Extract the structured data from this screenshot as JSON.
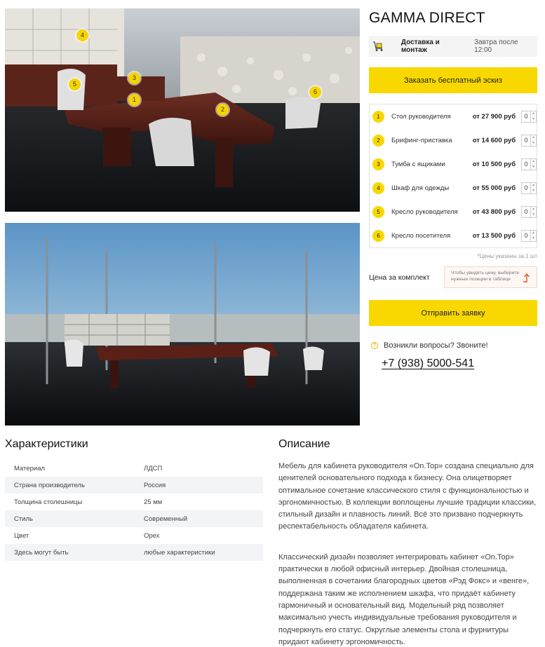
{
  "product": {
    "title": "GAMMA DIRECT"
  },
  "delivery": {
    "label": "Доставка и монтаж",
    "when": "Завтра после 12:00",
    "icon": "truck-icon"
  },
  "buttons": {
    "sketch": "Заказать бесплатный эскиз",
    "send": "Отправить заявку"
  },
  "photo_markers": [
    "1",
    "2",
    "3",
    "4",
    "5",
    "6"
  ],
  "items": [
    {
      "num": "1",
      "name": "Стол руководителя",
      "price": "от 27 900 руб",
      "qty": "0"
    },
    {
      "num": "2",
      "name": "Брифинг-приставка",
      "price": "от 14 600 руб",
      "qty": "0"
    },
    {
      "num": "3",
      "name": "Тумба с ящиками",
      "price": "от 10 500 руб",
      "qty": "0"
    },
    {
      "num": "4",
      "name": "Шкаф для одежды",
      "price": "от 55 000 руб",
      "qty": "0"
    },
    {
      "num": "5",
      "name": "Кресло руководителя",
      "price": "от 43 800 руб",
      "qty": "0"
    },
    {
      "num": "6",
      "name": "Кресло посетителя",
      "price": "от 13 500 руб",
      "qty": "0"
    }
  ],
  "price_note": "*Цены указаны за 1 шт",
  "kit": {
    "label": "Цена за комплект",
    "hint": "Чтобы увидеть цену, выберите нужные позиции в таблице"
  },
  "contact": {
    "question": "Возникли вопросы? Звоните!",
    "phone": "+7 (938) 5000-541"
  },
  "characteristics": {
    "title": "Характеристики",
    "rows": [
      {
        "key": "Материал",
        "value": "ЛДСП"
      },
      {
        "key": "Страна производитель",
        "value": "Россия"
      },
      {
        "key": "Толщина столешницы",
        "value": "25 мм"
      },
      {
        "key": "Стиль",
        "value": "Современный"
      },
      {
        "key": "Цвет",
        "value": "Орех"
      },
      {
        "key": "Здесь могут быть",
        "value": "любые характеристики"
      }
    ]
  },
  "description": {
    "title": "Описание",
    "paragraphs": [
      "Мебель для кабинета руководителя «On.Top» создана специально для ценителей основательного подхода к бизнесу. Она олицетворяет оптимальное сочетание классического стиля с функциональностью и эргономичностью. В коллекции воплощены лучшие традиции классики, стильный дизайн и плавность линий. Всё это призвано подчеркнуть респектабельность обладателя кабинета.",
      "Классический дизайн позволяет интегрировать кабинет «On.Top» практически в любой офисный интерьер. Двойная столешница, выполненная в сочетании благородных цветов «Рэд Фокс» и «венге», поддержана таким же исполнением шкафа, что придаёт кабинету гармоничный и основательный вид. Модельный ряд позволяет максимально учесть индивидуальные требования руководителя и подчеркнуть его статус. Округлые элементы стола и фурнитуры придают кабинету эргономичность."
    ]
  },
  "colors": {
    "accent": "#f8d800",
    "text": "#222222",
    "row_alt": "#f3f4f6"
  }
}
